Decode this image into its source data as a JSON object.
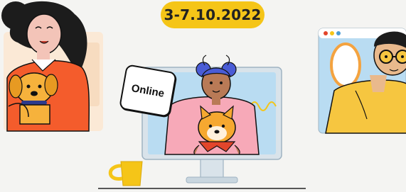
{
  "event": {
    "date": "3-7.10.2022",
    "mode_badge": "Online"
  },
  "colors": {
    "background": "#f4f4f2",
    "accent_yellow": "#f5c518",
    "hair_dark": "#1c1c1c",
    "hair_blue": "#4a5cd6",
    "shirt_orange": "#f45c2c",
    "jacket_pink": "#f7a9b8",
    "hoodie_yellow": "#f6c640",
    "screen_blue": "#b9dcf2",
    "monitor_frame": "#d9e3ea",
    "dog_fur": "#f6b23c",
    "scarf_red": "#e2452b",
    "window_orange": "#f4a340"
  },
  "icons": {
    "window_dots": [
      "red-dot-icon",
      "yellow-dot-icon",
      "blue-dot-icon"
    ],
    "decorations": [
      "squiggle-icon",
      "coffee-cup-icon"
    ]
  }
}
